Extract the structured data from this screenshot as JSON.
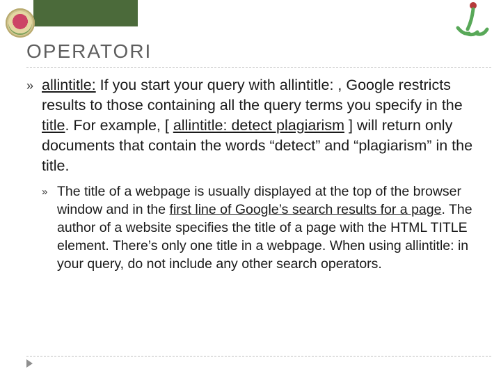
{
  "header": {
    "title": "OPERATORI"
  },
  "bullets": {
    "main": {
      "lead_underlined": "allintitle:",
      "part1": " If you start your query with allintitle: , Google restricts results to those containing all the query terms you specify in the ",
      "title_word": "title",
      "part2": ". For example, [ ",
      "example_underlined": "allintitle: detect plagiarism",
      "part3": " ] will return only documents that contain the words “detect” and “plagiarism” in the title."
    },
    "sub": {
      "part1": "The title of a webpage is usually displayed at the top of the browser window and in the ",
      "link_underlined": "first line of Google’s search results for a page",
      "part2": ". The author of a website specifies the title of a page with the HTML TITLE element. There’s only one title in a webpage. When using allintitle: in your query, do not include any other search operators."
    }
  },
  "icons": {
    "bullet_glyph": "»",
    "logo_right_alt": "green-stick-figure-logo"
  },
  "colors": {
    "bar": "#4b6a3a",
    "logo_right_dot": "#b63a3a",
    "logo_right_arc": "#58a858"
  }
}
